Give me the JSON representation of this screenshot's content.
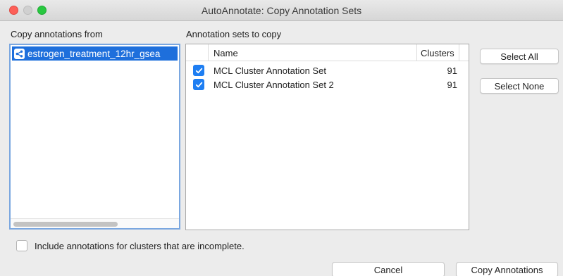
{
  "window": {
    "title": "AutoAnnotate: Copy Annotation Sets"
  },
  "source": {
    "label": "Copy annotations from",
    "networks": [
      {
        "name": "estrogen_treatment_12hr_gsea",
        "icon": "network-share-icon",
        "selected": true
      }
    ]
  },
  "sets": {
    "label": "Annotation sets to copy",
    "columns": [
      "",
      "Name",
      "Clusters"
    ],
    "rows": [
      {
        "checked": true,
        "name": "MCL Cluster Annotation Set",
        "clusters": "91"
      },
      {
        "checked": true,
        "name": "MCL Cluster Annotation Set 2",
        "clusters": "91"
      }
    ]
  },
  "buttons": {
    "select_all": "Select All",
    "select_none": "Select None",
    "cancel": "Cancel",
    "copy": "Copy Annotations"
  },
  "options": {
    "incomplete_label": "Include annotations for clusters that are incomplete.",
    "incomplete_checked": false
  },
  "colors": {
    "selection": "#1e6fdc",
    "checkbox": "#1e7ef2",
    "close": "#fd5f57",
    "maximize": "#28c840"
  }
}
